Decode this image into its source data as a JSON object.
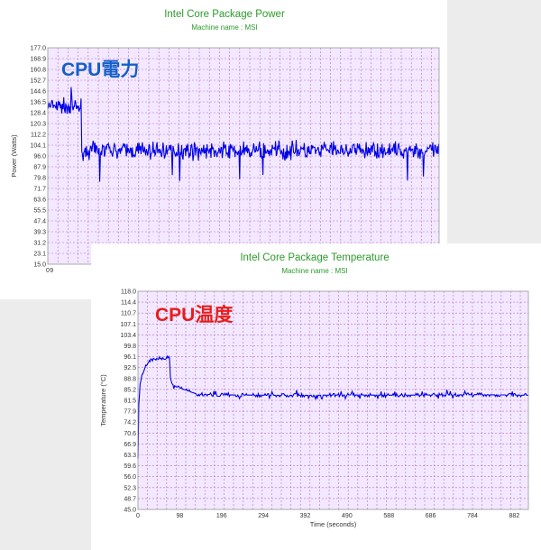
{
  "chart_data": [
    {
      "type": "line",
      "title": "Intel Core Package Power",
      "subtitle": "Machine name : MSI",
      "ylabel": "Power (Watts)",
      "xlabel": "",
      "ylim": [
        15.0,
        177.0
      ],
      "xlim": [
        0,
        940
      ],
      "yticks": [
        "177.0",
        "168.9",
        "160.8",
        "152.7",
        "144.6",
        "136.5",
        "128.4",
        "120.3",
        "112.2",
        "104.1",
        "96.0",
        "87.9",
        "79.8",
        "71.7",
        "63.6",
        "55.5",
        "47.4",
        "39.3",
        "31.2",
        "23.1",
        "15.0"
      ],
      "xticks": [
        "0",
        "9"
      ],
      "grid": true,
      "annotation": "CPU電力",
      "colors": {
        "series": "#0000e6",
        "plot_bg": "#f3e8ff",
        "grid": "#b070c8",
        "title": "#2c9a2c",
        "annotation": "#1560c8"
      },
      "series": [
        {
          "name": "",
          "description": "approx. 125-145 W for the first ~80 s, then fluctuates around ~100 W (roughly 87-114 W) for the rest of the run",
          "x": [
            0,
            80,
            940
          ],
          "y": [
            135,
            130,
            100
          ]
        }
      ]
    },
    {
      "type": "line",
      "title": "Intel Core Package Temperature",
      "subtitle": "Machine name : MSI",
      "ylabel": "Temperature (°C)",
      "xlabel": "Time (seconds)",
      "ylim": [
        45.0,
        118.0
      ],
      "xlim": [
        0,
        915
      ],
      "yticks": [
        "118.0",
        "114.4",
        "110.7",
        "107.1",
        "103.4",
        "99.8",
        "96.1",
        "92.5",
        "88.8",
        "85.2",
        "81.5",
        "77.9",
        "74.2",
        "70.6",
        "66.9",
        "63.3",
        "59.6",
        "56.0",
        "52.3",
        "48.7",
        "45.0"
      ],
      "xticks": [
        "0",
        "98",
        "196",
        "294",
        "392",
        "490",
        "588",
        "686",
        "784",
        "882"
      ],
      "grid": true,
      "annotation": "CPU温度",
      "colors": {
        "series": "#0000e6",
        "plot_bg": "#f3e8ff",
        "grid": "#b070c8",
        "title": "#2c9a2c",
        "annotation": "#e81c1c"
      },
      "series": [
        {
          "name": "",
          "x": [
            0,
            2,
            5,
            10,
            15,
            20,
            25,
            30,
            40,
            50,
            60,
            70,
            74,
            76,
            80,
            90,
            100,
            110,
            120,
            130,
            140,
            160,
            200,
            300,
            400,
            500,
            600,
            700,
            800,
            915
          ],
          "y": [
            62,
            80,
            87,
            90,
            92,
            93,
            94,
            95,
            95,
            95.5,
            95.5,
            96,
            96,
            89,
            87,
            86,
            85.5,
            85,
            84.5,
            84,
            83.5,
            83.5,
            83.3,
            83.2,
            83.2,
            83.3,
            83.2,
            83.3,
            83.4,
            83.2
          ]
        }
      ]
    }
  ]
}
